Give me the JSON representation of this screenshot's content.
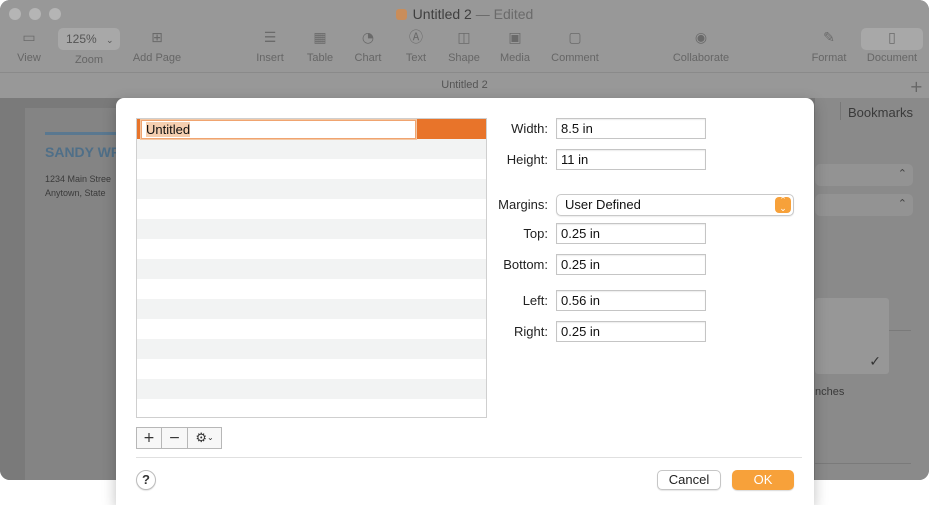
{
  "window": {
    "title": "Untitled 2",
    "edited_sep": "—",
    "edited": "Edited",
    "tab_title": "Untitled 2"
  },
  "toolbar": {
    "view": "View",
    "zoom_value": "125%",
    "zoom": "Zoom",
    "add_page": "Add Page",
    "insert": "Insert",
    "table": "Table",
    "chart": "Chart",
    "text": "Text",
    "shape": "Shape",
    "media": "Media",
    "comment": "Comment",
    "collaborate": "Collaborate",
    "format": "Format",
    "document": "Document"
  },
  "page": {
    "name": "SANDY WR",
    "addr1": "1234 Main Stree",
    "addr2": "Anytown, State"
  },
  "inspector": {
    "tab_partial": "Bookmarks",
    "text_partial": "nches"
  },
  "dialog": {
    "list": {
      "selected_name": "Untitled",
      "row_count": 15
    },
    "width_label": "Width:",
    "width_value": "8.5 in",
    "height_label": "Height:",
    "height_value": "11 in",
    "margins_label": "Margins:",
    "margins_value": "User Defined",
    "top_label": "Top:",
    "top_value": "0.25 in",
    "bottom_label": "Bottom:",
    "bottom_value": "0.25 in",
    "left_label": "Left:",
    "left_value": "0.56 in",
    "right_label": "Right:",
    "right_value": "0.25 in",
    "add_glyph": "+",
    "remove_glyph": "−",
    "action_glyph": "⚙",
    "help": "?",
    "cancel": "Cancel",
    "ok": "OK"
  },
  "colors": {
    "accent": "#f7a13a",
    "selection": "#e8742a"
  }
}
